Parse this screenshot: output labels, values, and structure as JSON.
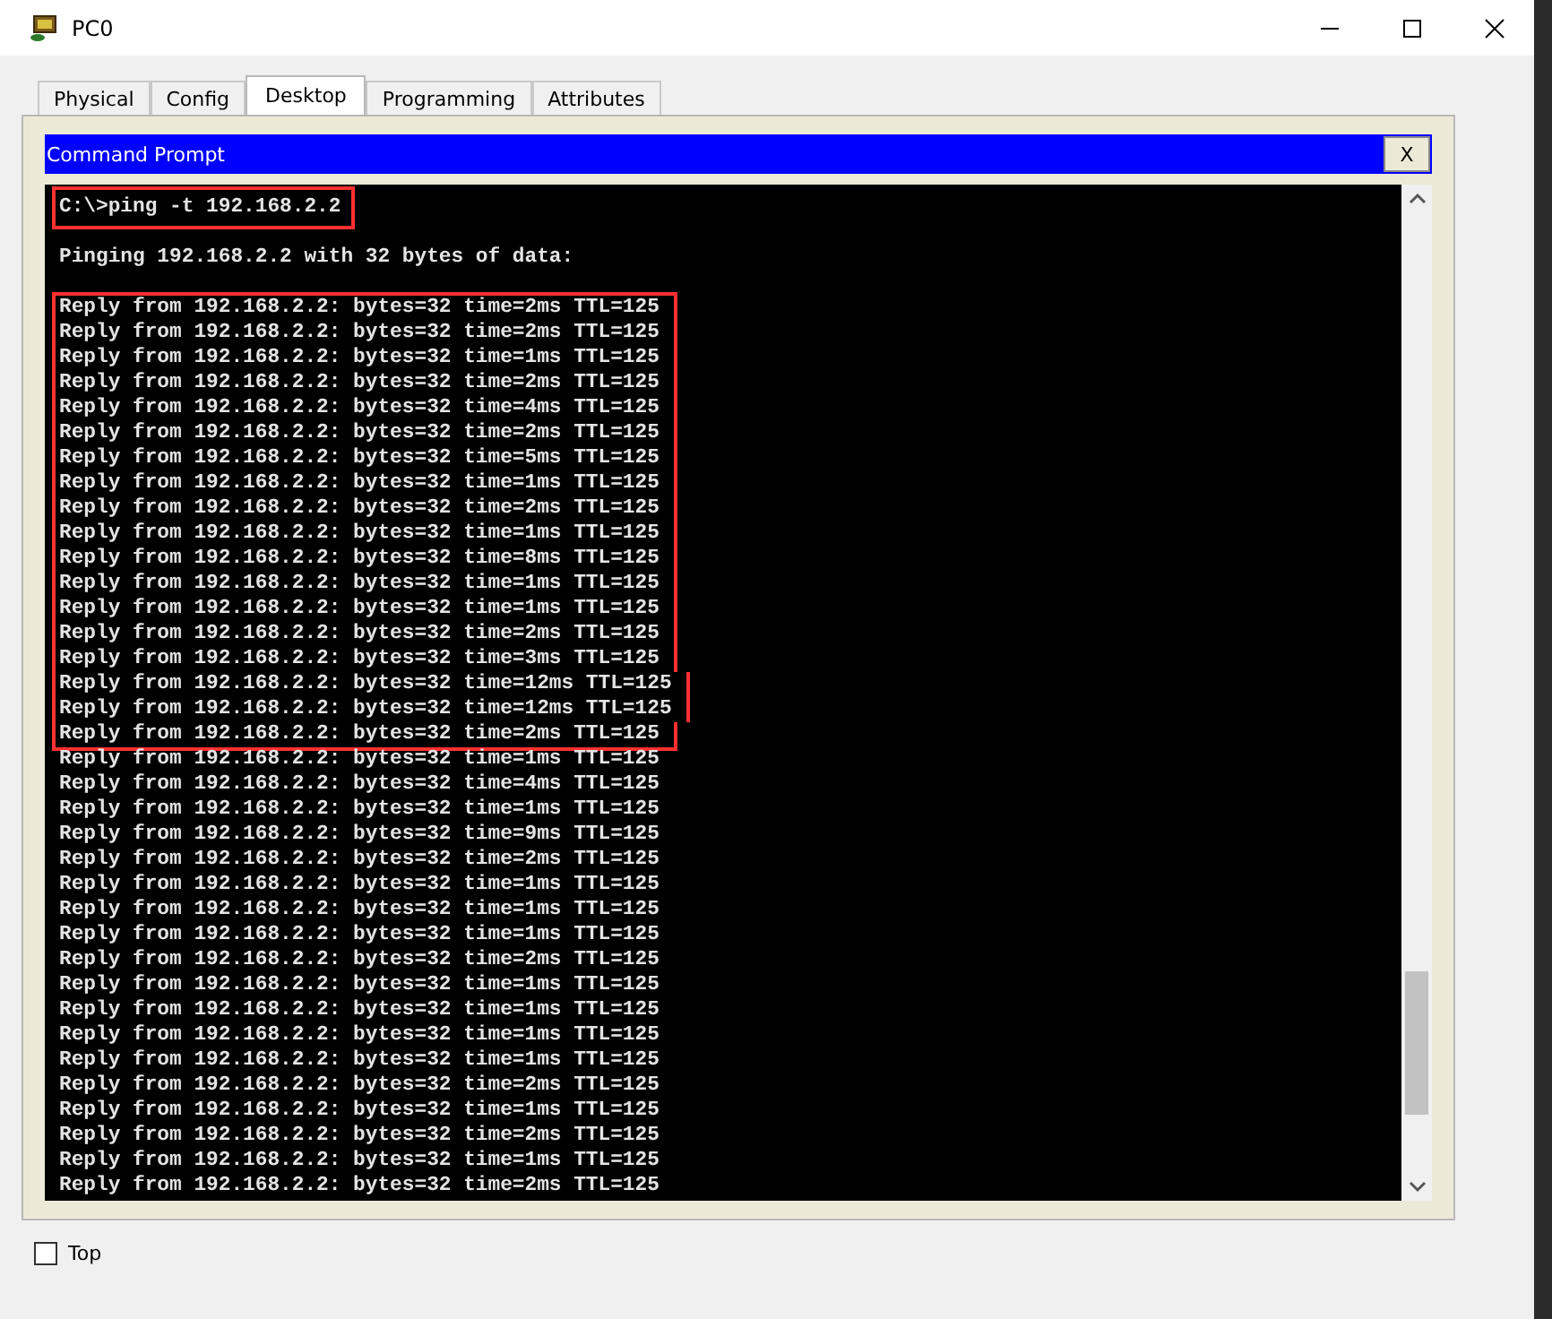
{
  "window": {
    "title": "PC0"
  },
  "tabs": [
    {
      "label": "Physical",
      "selected": false
    },
    {
      "label": "Config",
      "selected": false
    },
    {
      "label": "Desktop",
      "selected": true
    },
    {
      "label": "Programming",
      "selected": false
    },
    {
      "label": "Attributes",
      "selected": false
    }
  ],
  "command_prompt": {
    "title": "Command Prompt",
    "close_label": "X",
    "command": {
      "text": "C:\\>ping -t 192.168.2.2",
      "highlighted": true
    },
    "header": "Pinging 192.168.2.2 with 32 bytes of data:",
    "replies": [
      {
        "text": "Reply from 192.168.2.2: bytes=32 time=2ms TTL=125",
        "highlighted": true
      },
      {
        "text": "Reply from 192.168.2.2: bytes=32 time=2ms TTL=125",
        "highlighted": true
      },
      {
        "text": "Reply from 192.168.2.2: bytes=32 time=1ms TTL=125",
        "highlighted": true
      },
      {
        "text": "Reply from 192.168.2.2: bytes=32 time=2ms TTL=125",
        "highlighted": true
      },
      {
        "text": "Reply from 192.168.2.2: bytes=32 time=4ms TTL=125",
        "highlighted": true
      },
      {
        "text": "Reply from 192.168.2.2: bytes=32 time=2ms TTL=125",
        "highlighted": true
      },
      {
        "text": "Reply from 192.168.2.2: bytes=32 time=5ms TTL=125",
        "highlighted": true
      },
      {
        "text": "Reply from 192.168.2.2: bytes=32 time=1ms TTL=125",
        "highlighted": true
      },
      {
        "text": "Reply from 192.168.2.2: bytes=32 time=2ms TTL=125",
        "highlighted": true
      },
      {
        "text": "Reply from 192.168.2.2: bytes=32 time=1ms TTL=125",
        "highlighted": true
      },
      {
        "text": "Reply from 192.168.2.2: bytes=32 time=8ms TTL=125",
        "highlighted": true
      },
      {
        "text": "Reply from 192.168.2.2: bytes=32 time=1ms TTL=125",
        "highlighted": true
      },
      {
        "text": "Reply from 192.168.2.2: bytes=32 time=1ms TTL=125",
        "highlighted": true
      },
      {
        "text": "Reply from 192.168.2.2: bytes=32 time=2ms TTL=125",
        "highlighted": true
      },
      {
        "text": "Reply from 192.168.2.2: bytes=32 time=3ms TTL=125",
        "highlighted": true
      },
      {
        "text": "Reply from 192.168.2.2: bytes=32 time=12ms TTL=125",
        "highlighted": true
      },
      {
        "text": "Reply from 192.168.2.2: bytes=32 time=12ms TTL=125",
        "highlighted": true
      },
      {
        "text": "Reply from 192.168.2.2: bytes=32 time=2ms TTL=125",
        "highlighted": true
      },
      {
        "text": "Reply from 192.168.2.2: bytes=32 time=1ms TTL=125",
        "highlighted": false
      },
      {
        "text": "Reply from 192.168.2.2: bytes=32 time=4ms TTL=125",
        "highlighted": false
      },
      {
        "text": "Reply from 192.168.2.2: bytes=32 time=1ms TTL=125",
        "highlighted": false
      },
      {
        "text": "Reply from 192.168.2.2: bytes=32 time=9ms TTL=125",
        "highlighted": false
      },
      {
        "text": "Reply from 192.168.2.2: bytes=32 time=2ms TTL=125",
        "highlighted": false
      },
      {
        "text": "Reply from 192.168.2.2: bytes=32 time=1ms TTL=125",
        "highlighted": false
      },
      {
        "text": "Reply from 192.168.2.2: bytes=32 time=1ms TTL=125",
        "highlighted": false
      },
      {
        "text": "Reply from 192.168.2.2: bytes=32 time=1ms TTL=125",
        "highlighted": false
      },
      {
        "text": "Reply from 192.168.2.2: bytes=32 time=2ms TTL=125",
        "highlighted": false
      },
      {
        "text": "Reply from 192.168.2.2: bytes=32 time=1ms TTL=125",
        "highlighted": false
      },
      {
        "text": "Reply from 192.168.2.2: bytes=32 time=1ms TTL=125",
        "highlighted": false
      },
      {
        "text": "Reply from 192.168.2.2: bytes=32 time=1ms TTL=125",
        "highlighted": false
      },
      {
        "text": "Reply from 192.168.2.2: bytes=32 time=1ms TTL=125",
        "highlighted": false
      },
      {
        "text": "Reply from 192.168.2.2: bytes=32 time=2ms TTL=125",
        "highlighted": false
      },
      {
        "text": "Reply from 192.168.2.2: bytes=32 time=1ms TTL=125",
        "highlighted": false
      },
      {
        "text": "Reply from 192.168.2.2: bytes=32 time=2ms TTL=125",
        "highlighted": false
      },
      {
        "text": "Reply from 192.168.2.2: bytes=32 time=1ms TTL=125",
        "highlighted": false
      },
      {
        "text": "Reply from 192.168.2.2: bytes=32 time=2ms TTL=125",
        "highlighted": false
      }
    ]
  },
  "top_option": {
    "label": "Top",
    "checked": false
  }
}
